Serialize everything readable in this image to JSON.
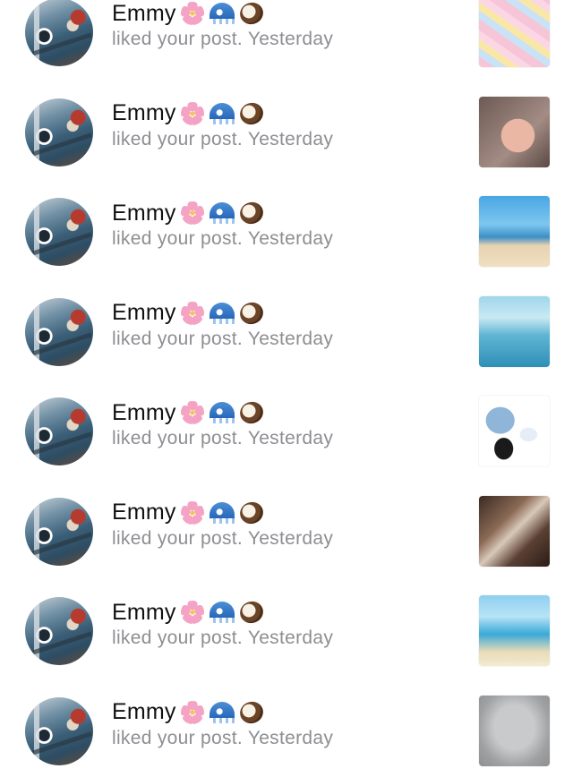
{
  "notifications": [
    {
      "name": "Emmy",
      "emojis": [
        "flower-icon",
        "wave-icon",
        "coconut-icon"
      ],
      "action": "liked your post.",
      "time": "Yesterday",
      "thumbnail": "lip-gloss-thumbnail"
    },
    {
      "name": "Emmy",
      "emojis": [
        "flower-icon",
        "wave-icon",
        "coconut-icon"
      ],
      "action": "liked your post.",
      "time": "Yesterday",
      "thumbnail": "pink-nails-thumbnail"
    },
    {
      "name": "Emmy",
      "emojis": [
        "flower-icon",
        "wave-icon",
        "coconut-icon"
      ],
      "action": "liked your post.",
      "time": "Yesterday",
      "thumbnail": "beach-thumbnail"
    },
    {
      "name": "Emmy",
      "emojis": [
        "flower-icon",
        "wave-icon",
        "coconut-icon"
      ],
      "action": "liked your post.",
      "time": "Yesterday",
      "thumbnail": "summer-wallpaper-thumbnail"
    },
    {
      "name": "Emmy",
      "emojis": [
        "flower-icon",
        "wave-icon",
        "coconut-icon"
      ],
      "action": "liked your post.",
      "time": "Yesterday",
      "thumbnail": "outfit-thumbnail"
    },
    {
      "name": "Emmy",
      "emojis": [
        "flower-icon",
        "wave-icon",
        "coconut-icon"
      ],
      "action": "liked your post.",
      "time": "Yesterday",
      "thumbnail": "cabinet-thumbnail"
    },
    {
      "name": "Emmy",
      "emojis": [
        "flower-icon",
        "wave-icon",
        "coconut-icon"
      ],
      "action": "liked your post.",
      "time": "Yesterday",
      "thumbnail": "summer-beach-thumbnail"
    },
    {
      "name": "Emmy",
      "emojis": [
        "flower-icon",
        "wave-icon",
        "coconut-icon"
      ],
      "action": "liked your post.",
      "time": "Yesterday",
      "thumbnail": "paper-note-thumbnail"
    }
  ]
}
